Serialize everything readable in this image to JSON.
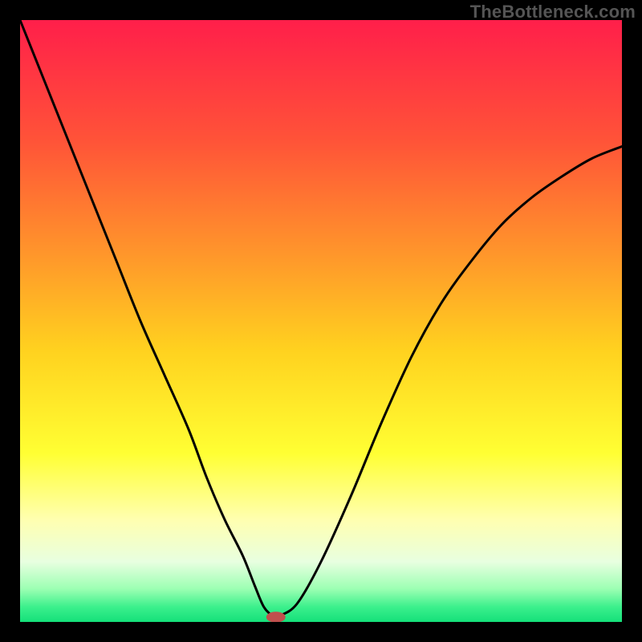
{
  "attribution": "TheBottleneck.com",
  "chart_data": {
    "type": "line",
    "title": "",
    "xlabel": "",
    "ylabel": "",
    "xlim": [
      0,
      100
    ],
    "ylim": [
      0,
      100
    ],
    "background_gradient": {
      "stops": [
        {
          "offset": 0.0,
          "color": "#ff1f4a"
        },
        {
          "offset": 0.2,
          "color": "#ff5338"
        },
        {
          "offset": 0.4,
          "color": "#ff9a2a"
        },
        {
          "offset": 0.55,
          "color": "#ffd21f"
        },
        {
          "offset": 0.72,
          "color": "#ffff33"
        },
        {
          "offset": 0.83,
          "color": "#ffffb0"
        },
        {
          "offset": 0.9,
          "color": "#e8ffe0"
        },
        {
          "offset": 0.945,
          "color": "#9cffb3"
        },
        {
          "offset": 0.975,
          "color": "#3cf08c"
        },
        {
          "offset": 1.0,
          "color": "#14e07a"
        }
      ]
    },
    "series": [
      {
        "name": "bottleneck-curve",
        "x": [
          0,
          4,
          8,
          12,
          16,
          20,
          24,
          28,
          31,
          34,
          37,
          39,
          40.5,
          42,
          43,
          46,
          50,
          55,
          60,
          65,
          70,
          75,
          80,
          85,
          90,
          95,
          100
        ],
        "y": [
          100,
          90,
          80,
          70,
          60,
          50,
          41,
          32,
          24,
          17,
          11,
          6,
          2.5,
          1,
          1,
          3,
          10,
          21,
          33,
          44,
          53,
          60,
          66,
          70.5,
          74,
          77,
          79
        ]
      }
    ],
    "marker": {
      "name": "optimum-point",
      "x": 42.5,
      "y": 0.8,
      "rx": 1.6,
      "ry": 0.9,
      "color": "#c0504d"
    }
  }
}
